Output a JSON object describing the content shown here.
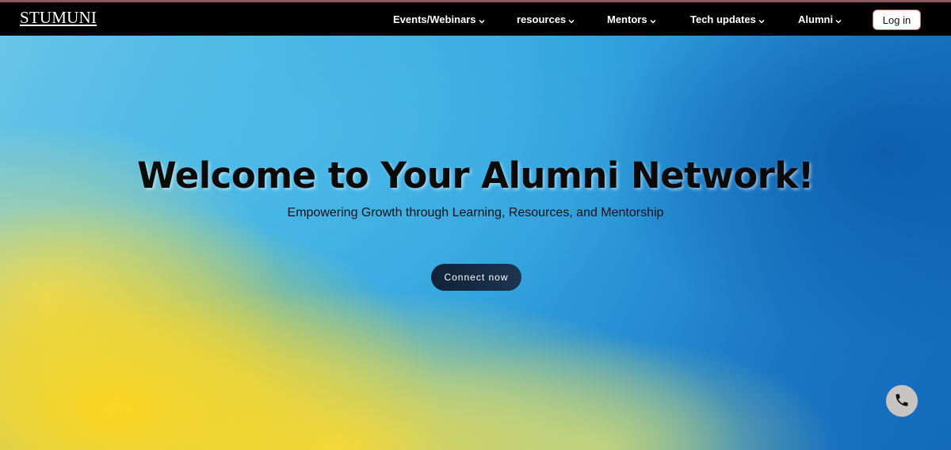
{
  "nav": {
    "logo": "STUMUNI",
    "items": [
      {
        "label": "Events/Webinars",
        "icon": "chevron-down-icon"
      },
      {
        "label": "resources",
        "icon": "chevron-down-icon"
      },
      {
        "label": "Mentors",
        "icon": "chevron-down-icon"
      },
      {
        "label": "Tech updates",
        "icon": "chevron-down-icon"
      },
      {
        "label": "Alumni",
        "icon": "chevron-down-icon"
      }
    ],
    "login_label": "Log in"
  },
  "hero": {
    "title": "Welcome to Your Alumni Network!",
    "subtitle": "Empowering Growth through Learning, Resources, and Mentorship",
    "cta_label": "Connect now"
  },
  "floating": {
    "call_icon": "phone-icon"
  },
  "colors": {
    "navbar_bg": "#000000",
    "cta_bg": "#0f2238",
    "call_button_bg": "#c9c4c4",
    "login_border": "#c96a5a"
  }
}
